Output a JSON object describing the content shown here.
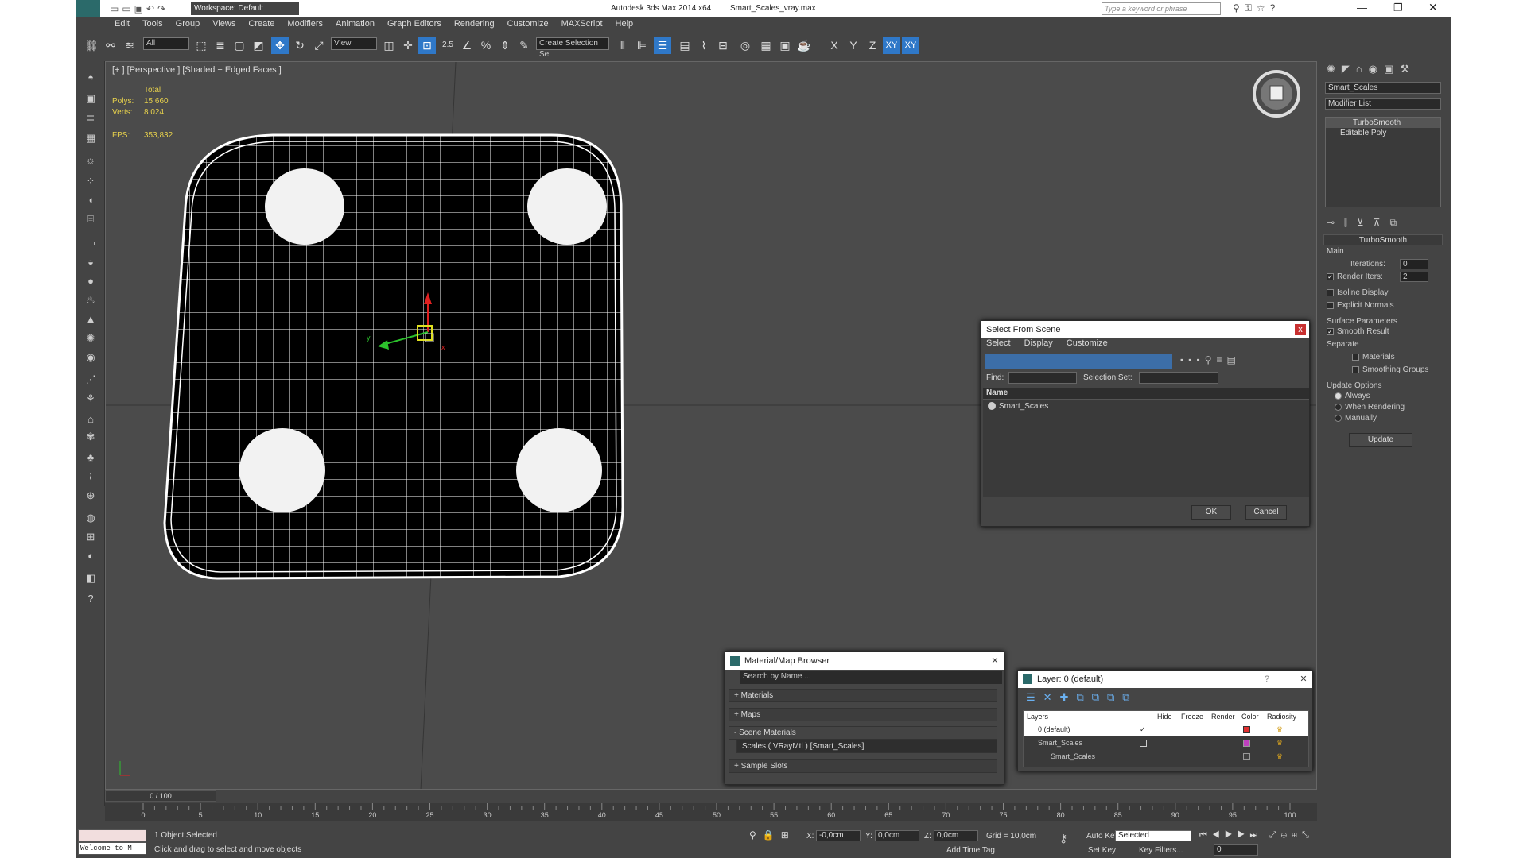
{
  "title": {
    "app": "Autodesk 3ds Max  2014 x64",
    "file": "Smart_Scales_vray.max",
    "workspace": "Workspace: Default",
    "search_placeholder": "Type a keyword or phrase"
  },
  "menu": [
    "Edit",
    "Tools",
    "Group",
    "Views",
    "Create",
    "Modifiers",
    "Animation",
    "Graph Editors",
    "Rendering",
    "Customize",
    "MAXScript",
    "Help"
  ],
  "toolbar": {
    "filter": "All",
    "coord": "View",
    "snap_value": "2.5",
    "selection_set": "Create Selection Se",
    "axes": [
      "X",
      "Y",
      "Z",
      "XY",
      "XY"
    ]
  },
  "viewport": {
    "label": "[+ ] [Perspective ] [Shaded + Edged Faces ]",
    "stats": {
      "total": "Total",
      "polys_label": "Polys:",
      "polys": "15 660",
      "verts_label": "Verts:",
      "verts": "8 024",
      "fps_label": "FPS:",
      "fps": "353,832"
    },
    "gizmo": {
      "x": "x",
      "y": "y"
    }
  },
  "command_panel": {
    "object_name": "Smart_Scales",
    "modifier_list": "Modifier List",
    "stack": [
      "TurboSmooth",
      "Editable Poly"
    ],
    "rollout_title": "TurboSmooth",
    "main": "Main",
    "iterations_label": "Iterations:",
    "iterations": "0",
    "render_iters_label": "Render Iters:",
    "render_iters": "2",
    "isoline": "Isoline Display",
    "explicit": "Explicit Normals",
    "surface": "Surface Parameters",
    "smooth_result": "Smooth Result",
    "separate": "Separate",
    "materials": "Materials",
    "smoothing_groups": "Smoothing Groups",
    "update_options": "Update Options",
    "always": "Always",
    "when_rendering": "When Rendering",
    "manually": "Manually",
    "update": "Update"
  },
  "select_dialog": {
    "title": "Select From Scene",
    "menu": [
      "Select",
      "Display",
      "Customize"
    ],
    "find": "Find:",
    "selection_set": "Selection Set:",
    "column": "Name",
    "items": [
      "Smart_Scales"
    ],
    "ok": "OK",
    "cancel": "Cancel"
  },
  "material_browser": {
    "title": "Material/Map Browser",
    "search": "Search by Name ...",
    "sections": [
      "+ Materials",
      "+ Maps",
      "- Scene Materials",
      "+ Sample Slots"
    ],
    "scene_item": "Scales  ( VRayMtl ) [Smart_Scales]"
  },
  "layer_dialog": {
    "title": "Layer: 0 (default)",
    "help": "?",
    "columns": [
      "Layers",
      "Hide",
      "Freeze",
      "Render",
      "Color",
      "Radiosity"
    ],
    "rows": [
      {
        "name": "0 (default)",
        "color": "#e03030"
      },
      {
        "name": "Smart_Scales",
        "color": "#c040c0"
      },
      {
        "name": "Smart_Scales",
        "color": "#404040"
      }
    ]
  },
  "timeline": {
    "frame": "0 / 100",
    "ticks": [
      "0",
      "5",
      "10",
      "15",
      "20",
      "25",
      "30",
      "35",
      "40",
      "45",
      "50",
      "55",
      "60",
      "65",
      "70",
      "75",
      "80",
      "85",
      "90",
      "95",
      "100"
    ]
  },
  "status": {
    "maxscript": "Welcome to M",
    "selected": "1 Object Selected",
    "prompt": "Click and drag to select and move objects",
    "x_label": "X:",
    "x": "-0,0cm",
    "y_label": "Y:",
    "y": "0,0cm",
    "z_label": "Z:",
    "z": "0,0cm",
    "grid": "Grid = 10,0cm",
    "add_time_tag": "Add Time Tag",
    "auto_key": "Auto Key",
    "set_key": "Set Key",
    "key_mode": "Selected",
    "key_filters": "Key Filters...",
    "frame": "0"
  }
}
